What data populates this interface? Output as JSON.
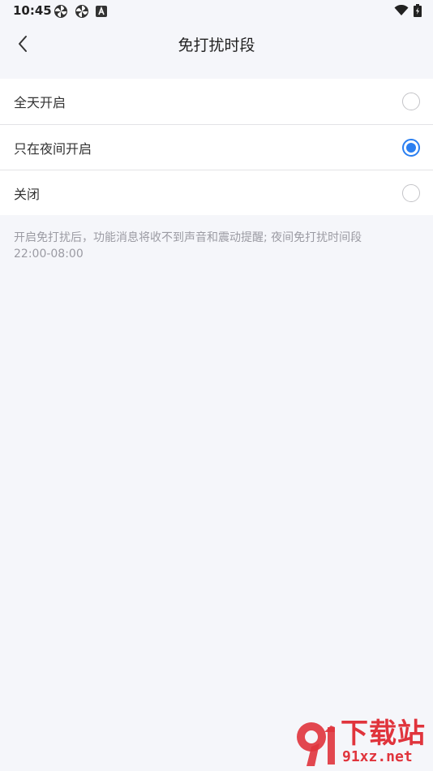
{
  "status": {
    "time": "10:45",
    "left_icons": [
      "pinwheel-icon",
      "pinwheel-icon",
      "a-box-icon"
    ],
    "right_icons": [
      "wifi-icon",
      "battery-charging-icon"
    ]
  },
  "header": {
    "title": "免打扰时段"
  },
  "options": [
    {
      "label": "全天开启",
      "selected": false
    },
    {
      "label": "只在夜间开启",
      "selected": true
    },
    {
      "label": "关闭",
      "selected": false
    }
  ],
  "hint": {
    "line1": "开启免打扰后，功能消息将收不到声音和震动提醒; 夜间免打扰时间段",
    "line2": "22:00-08:00"
  },
  "watermark": {
    "title": "下载站",
    "domain": "91xz.net",
    "logo_text": "91"
  },
  "colors": {
    "accent": "#2b7ff1",
    "background": "#f5f6fa",
    "watermark": "#e0343c"
  }
}
